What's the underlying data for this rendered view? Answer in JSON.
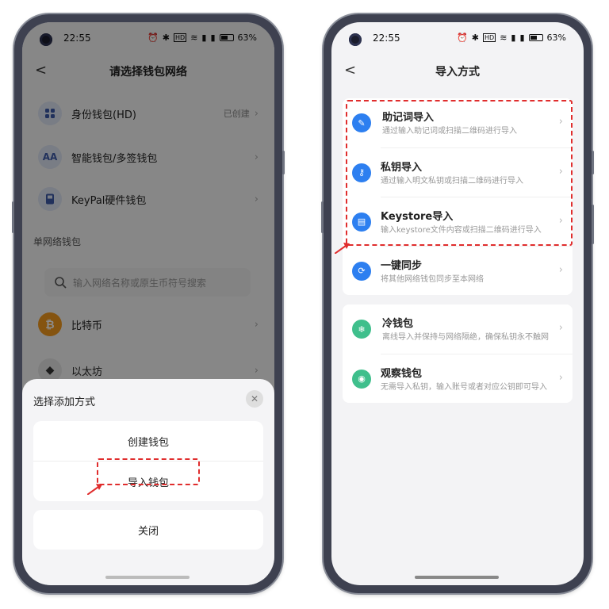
{
  "status": {
    "time": "22:55",
    "battery": "63%",
    "icons": [
      "alarm-icon",
      "bluetooth-icon",
      "hd-icon",
      "wifi-icon",
      "signal-icon",
      "signal-icon-2",
      "battery-icon"
    ]
  },
  "left": {
    "title": "请选择钱包网络",
    "wallet_items": [
      {
        "label": "身份钱包(HD)",
        "aux": "已创建",
        "icon": "grid-icon"
      },
      {
        "label": "智能钱包/多签钱包",
        "aux": "",
        "icon_text": "AA"
      },
      {
        "label": "KeyPal硬件钱包",
        "aux": "",
        "icon": "device-icon"
      }
    ],
    "section_label": "单网络钱包",
    "search_placeholder": "输入网络名称或原生币符号搜索",
    "networks": [
      {
        "label": "比特币",
        "icon": "bitcoin-icon",
        "color": "#f39a1e"
      },
      {
        "label": "以太坊",
        "icon": "ethereum-icon",
        "color": "#555555"
      }
    ],
    "sheet": {
      "title": "选择添加方式",
      "create": "创建钱包",
      "import": "导入钱包",
      "close": "关闭"
    }
  },
  "right": {
    "title": "导入方式",
    "group1": [
      {
        "title": "助记词导入",
        "desc": "通过输入助记词或扫描二维码进行导入",
        "icon": "note-icon",
        "color": "#2d7ff0"
      },
      {
        "title": "私钥导入",
        "desc": "通过输入明文私钥或扫描二维码进行导入",
        "icon": "key-icon",
        "color": "#2d7ff0"
      },
      {
        "title": "Keystore导入",
        "desc": "输入keystore文件内容或扫描二维码进行导入",
        "icon": "file-icon",
        "color": "#2d7ff0"
      },
      {
        "title": "一键同步",
        "desc": "将其他网络钱包同步至本网络",
        "icon": "sync-icon",
        "color": "#2d7ff0"
      }
    ],
    "group2": [
      {
        "title": "冷钱包",
        "desc": "离线导入并保持与网络隔绝，确保私钥永不触网",
        "icon": "cold-wallet-icon",
        "color": "#3fbf8c"
      },
      {
        "title": "观察钱包",
        "desc": "无需导入私钥，输入账号或者对应公钥即可导入",
        "icon": "eye-icon",
        "color": "#3fbf8c"
      }
    ]
  },
  "colors": {
    "highlight": "#e02d2d",
    "primary": "#2d7ff0",
    "green": "#3fbf8c"
  }
}
